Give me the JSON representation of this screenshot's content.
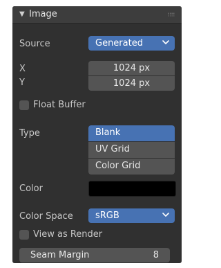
{
  "panel": {
    "title": "Image",
    "collapse_icon": "triangle-down-icon",
    "drag_icon": "grip-dots-icon"
  },
  "source": {
    "label": "Source",
    "value": "Generated"
  },
  "size": {
    "x_label": "X",
    "x_value": "1024 px",
    "y_label": "Y",
    "y_value": "1024 px"
  },
  "float_buffer": {
    "label": "Float Buffer",
    "checked": false
  },
  "type": {
    "label": "Type",
    "options": [
      "Blank",
      "UV Grid",
      "Color Grid"
    ],
    "selected": "Blank"
  },
  "color": {
    "label": "Color",
    "value": "#000000"
  },
  "color_space": {
    "label": "Color Space",
    "value": "sRGB"
  },
  "view_as_render": {
    "label": "View as Render",
    "checked": false
  },
  "seam_margin": {
    "label": "Seam Margin",
    "value": "8"
  },
  "colors": {
    "panel_bg": "#303030",
    "header_bg": "#3d3d3d",
    "accent": "#4772b3",
    "field_bg": "#545454",
    "text": "#c8c8c8"
  }
}
